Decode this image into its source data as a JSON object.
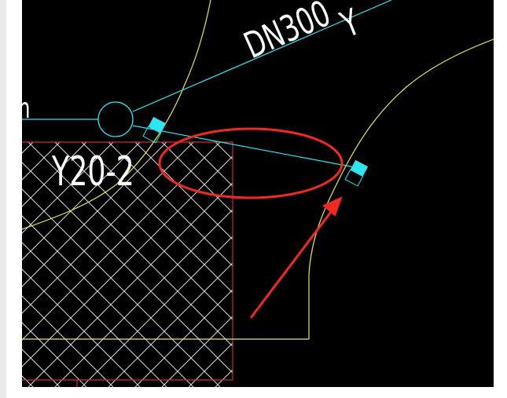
{
  "drawing": {
    "background": "#000000",
    "labels": {
      "pipe_label": "DN300",
      "pipe_suffix": "Y",
      "area_label": "Y20-2",
      "cut_text": "m"
    },
    "colors": {
      "pipe": "#2fe6f0",
      "contour": "#e8e84a",
      "hatch": "#d9d9d9",
      "boundary": "#c0303a",
      "annotation": "#f02a22"
    },
    "annotations": {
      "highlight_ellipse": "red-ellipse",
      "pointer_arrow": "red-arrow"
    }
  }
}
